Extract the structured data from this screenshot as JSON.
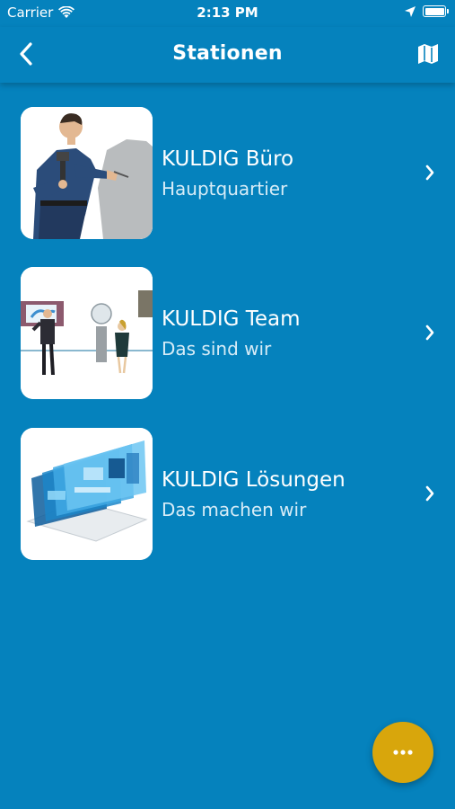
{
  "status_bar": {
    "carrier": "Carrier",
    "time": "2:13 PM"
  },
  "nav": {
    "title": "Stationen",
    "back_icon": "chevron-left-icon",
    "map_icon": "map-icon"
  },
  "stations": [
    {
      "title": "KULDIG Büro",
      "subtitle": "Hauptquartier"
    },
    {
      "title": "KULDIG Team",
      "subtitle": "Das sind wir"
    },
    {
      "title": "KULDIG Lösungen",
      "subtitle": "Das machen wir"
    }
  ],
  "fab": {
    "icon": "more-icon"
  },
  "colors": {
    "background": "#0582bd",
    "fab": "#d8a60c",
    "text": "#ffffff"
  }
}
